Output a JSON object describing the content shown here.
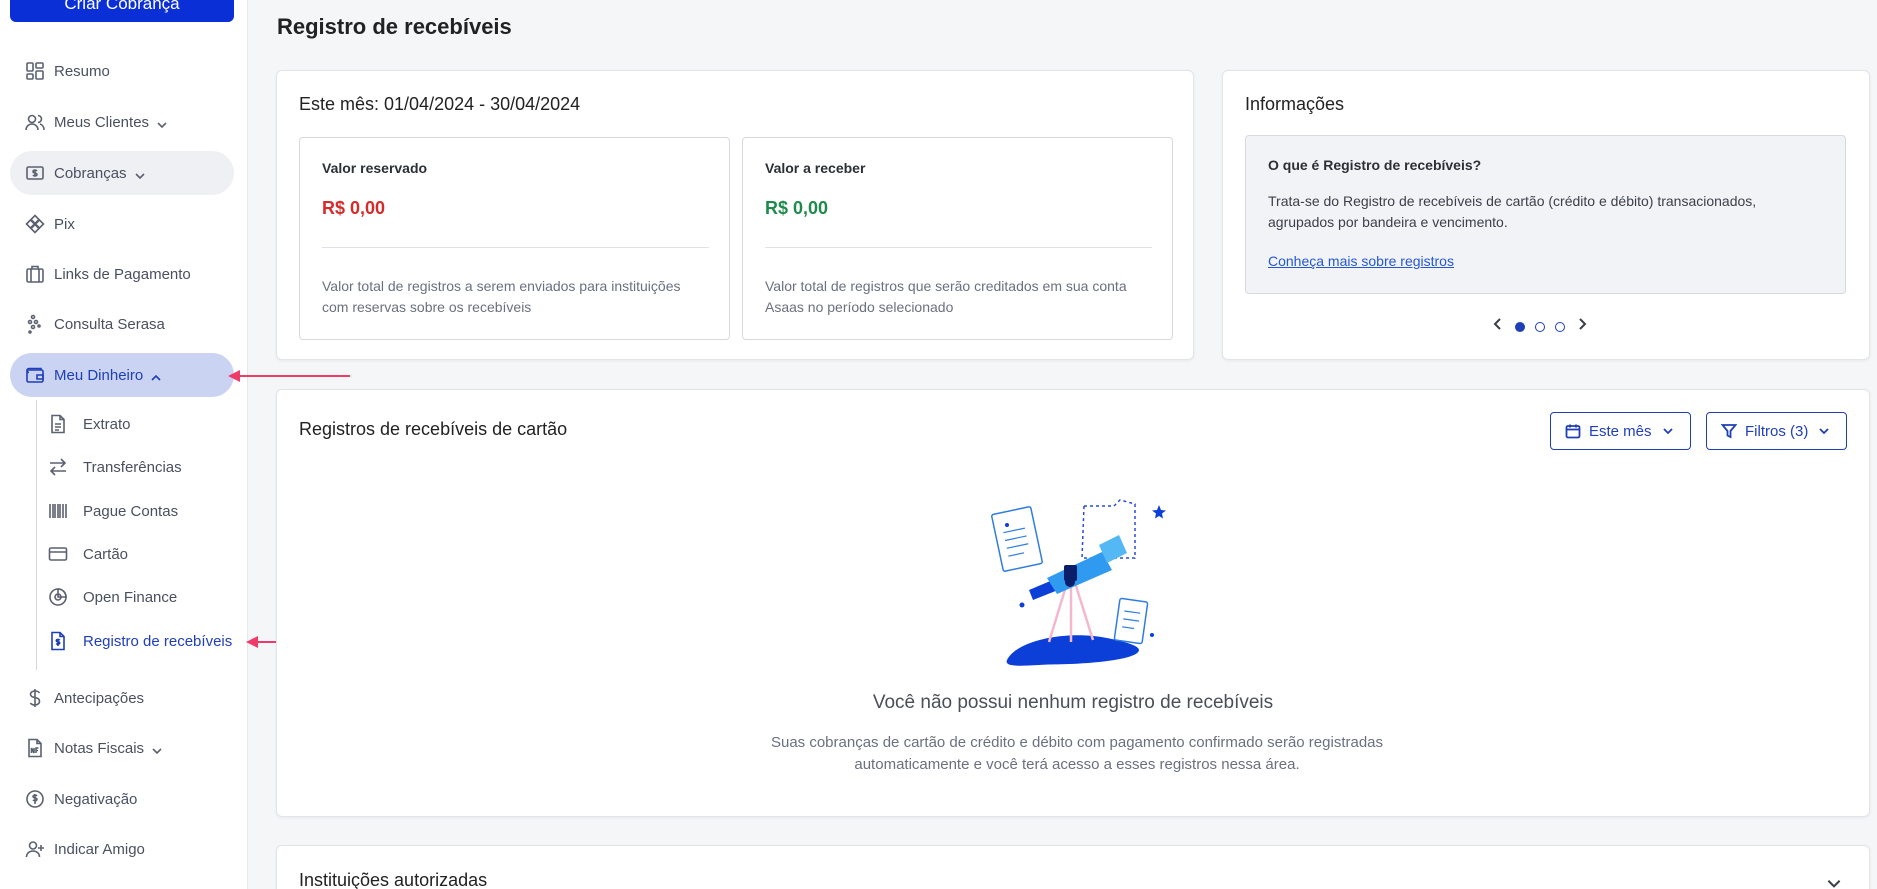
{
  "sidebar": {
    "cta": "Criar Cobrança",
    "items": [
      {
        "label": "Resumo",
        "icon": "dashboard-icon"
      },
      {
        "label": "Meus Clientes",
        "icon": "users-icon"
      },
      {
        "label": "Cobranças",
        "icon": "money-icon"
      },
      {
        "label": "Pix",
        "icon": "pix-icon"
      },
      {
        "label": "Links de Pagamento",
        "icon": "briefcase-icon"
      },
      {
        "label": "Consulta Serasa",
        "icon": "serasa-icon"
      },
      {
        "label": "Meu Dinheiro",
        "icon": "wallet-icon"
      },
      {
        "label": "Antecipações",
        "icon": "dollar-icon"
      },
      {
        "label": "Notas Fiscais",
        "icon": "invoice-icon"
      },
      {
        "label": "Negativação",
        "icon": "negativation-icon"
      },
      {
        "label": "Indicar Amigo",
        "icon": "add-user-icon"
      }
    ],
    "subitems": [
      {
        "label": "Extrato",
        "icon": "document-icon"
      },
      {
        "label": "Transferências",
        "icon": "transfer-icon"
      },
      {
        "label": "Pague Contas",
        "icon": "barcode-icon"
      },
      {
        "label": "Cartão",
        "icon": "card-icon"
      },
      {
        "label": "Open Finance",
        "icon": "open-finance-icon"
      },
      {
        "label": "Registro de recebíveis",
        "icon": "receivables-icon"
      }
    ]
  },
  "page": {
    "title": "Registro de recebíveis"
  },
  "month_card": {
    "title": "Este mês: 01/04/2024 - 30/04/2024",
    "reserved": {
      "label": "Valor reservado",
      "value": "R$ 0,00",
      "description": "Valor total de registros a serem enviados para instituições com reservas sobre os recebíveis",
      "color": "#d62b2b"
    },
    "receivable": {
      "label": "Valor a receber",
      "value": "R$ 0,00",
      "description": "Valor total de registros que serão creditados em sua conta Asaas no período selecionado",
      "color": "#1e8a4c"
    }
  },
  "info_card": {
    "title": "Informações",
    "question": "O que é Registro de recebíveis?",
    "answer": "Trata-se do Registro de recebíveis de cartão (crédito e débito) transacionados, agrupados por bandeira e vencimento.",
    "link": "Conheça mais sobre registros",
    "carousel": {
      "pages": 3,
      "current": 1
    }
  },
  "records_card": {
    "title": "Registros de recebíveis de cartão",
    "period_button": "Este mês",
    "filters_button": "Filtros (3)",
    "empty_title": "Você não possui nenhum registro de recebíveis",
    "empty_description": "Suas cobranças de cartão de crédito e débito com pagamento confirmado serão registradas automaticamente e você terá acesso a esses registros nessa área."
  },
  "institutions_card": {
    "title": "Instituições autorizadas"
  },
  "colors": {
    "brand": "#0a2fd6",
    "accent": "#1f3fb8",
    "annotation_arrow": "#ef3b6a"
  }
}
